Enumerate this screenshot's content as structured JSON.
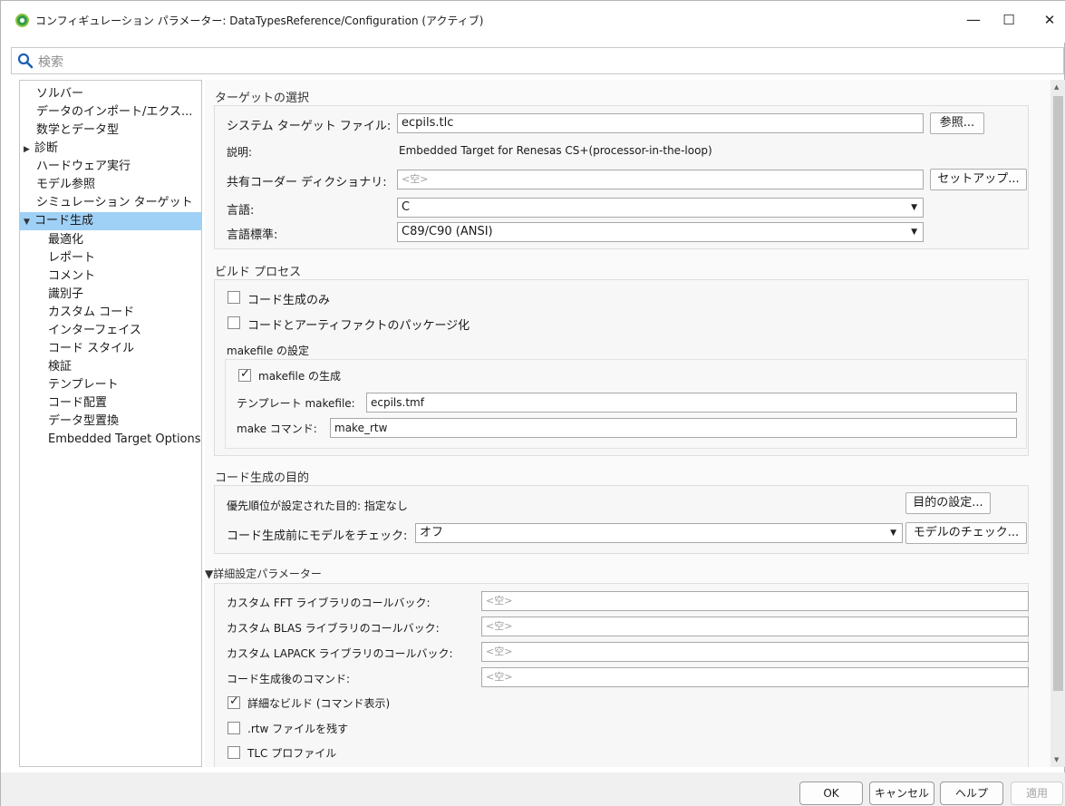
{
  "window": {
    "title": "コンフィギュレーション パラメーター: DataTypesReference/Configuration (アクティブ)",
    "minimize": "—",
    "maximize": "☐",
    "close": "✕"
  },
  "search": {
    "placeholder": "検索"
  },
  "tree": {
    "items": [
      {
        "label": "ソルバー"
      },
      {
        "label": "データのインポート/エクス..."
      },
      {
        "label": "数学とデータ型"
      },
      {
        "label": "診断",
        "arrow": "▶"
      },
      {
        "label": "ハードウェア実行"
      },
      {
        "label": "モデル参照"
      },
      {
        "label": "シミュレーション ターゲット"
      },
      {
        "label": "コード生成",
        "arrow": "▼",
        "selected": true
      },
      {
        "label": "最適化"
      },
      {
        "label": "レポート"
      },
      {
        "label": "コメント"
      },
      {
        "label": "識別子"
      },
      {
        "label": "カスタム コード"
      },
      {
        "label": "インターフェイス"
      },
      {
        "label": "コード スタイル"
      },
      {
        "label": "検証"
      },
      {
        "label": "テンプレート"
      },
      {
        "label": "コード配置"
      },
      {
        "label": "データ型置換"
      },
      {
        "label": "Embedded Target Options"
      }
    ]
  },
  "target": {
    "title": "ターゲットの選択",
    "stf_label": "システム ターゲット ファイル:",
    "stf_value": "ecpils.tlc",
    "browse_button": "参照...",
    "desc_label": "説明:",
    "desc_value": "Embedded Target for Renesas CS+(processor-in-the-loop)",
    "dict_label": "共有コーダー ディクショナリ:",
    "dict_value": "<空>",
    "setup_button": "セットアップ...",
    "lang_label": "言語:",
    "lang_value": "C",
    "std_label": "言語標準:",
    "std_value": "C89/C90 (ANSI)"
  },
  "build": {
    "title": "ビルド プロセス",
    "gen_only": "コード生成のみ",
    "gen_only_checked": false,
    "package": "コードとアーティファクトのパッケージ化",
    "package_checked": false,
    "makefile_title": "makefile の設定",
    "gen_makefile": "makefile の生成",
    "gen_makefile_checked": true,
    "tmf_label": "テンプレート makefile:",
    "tmf_value": "ecpils.tmf",
    "make_label": "make コマンド:",
    "make_value": "make_rtw"
  },
  "objectives": {
    "title": "コード生成の目的",
    "priority_label": "優先順位が設定された目的: 指定なし",
    "set_button": "目的の設定...",
    "check_label": "コード生成前にモデルをチェック:",
    "check_value": "オフ",
    "check_button": "モデルのチェック..."
  },
  "advanced": {
    "title": "▼詳細設定パラメーター",
    "fft_label": "カスタム FFT ライブラリのコールバック:",
    "fft_value": "<空>",
    "blas_label": "カスタム BLAS ライブラリのコールバック:",
    "blas_value": "<空>",
    "lapack_label": "カスタム LAPACK ライブラリのコールバック:",
    "lapack_value": "<空>",
    "postcmd_label": "コード生成後のコマンド:",
    "postcmd_value": "<空>",
    "verbose": "詳細なビルド (コマンド表示)",
    "verbose_checked": true,
    "retain_rtw": ".rtw ファイルを残す",
    "retain_rtw_checked": false,
    "tlc_profile": "TLC プロファイル",
    "tlc_profile_checked": false
  },
  "footer": {
    "ok": "OK",
    "cancel": "キャンセル",
    "help": "ヘルプ",
    "apply": "適用"
  }
}
